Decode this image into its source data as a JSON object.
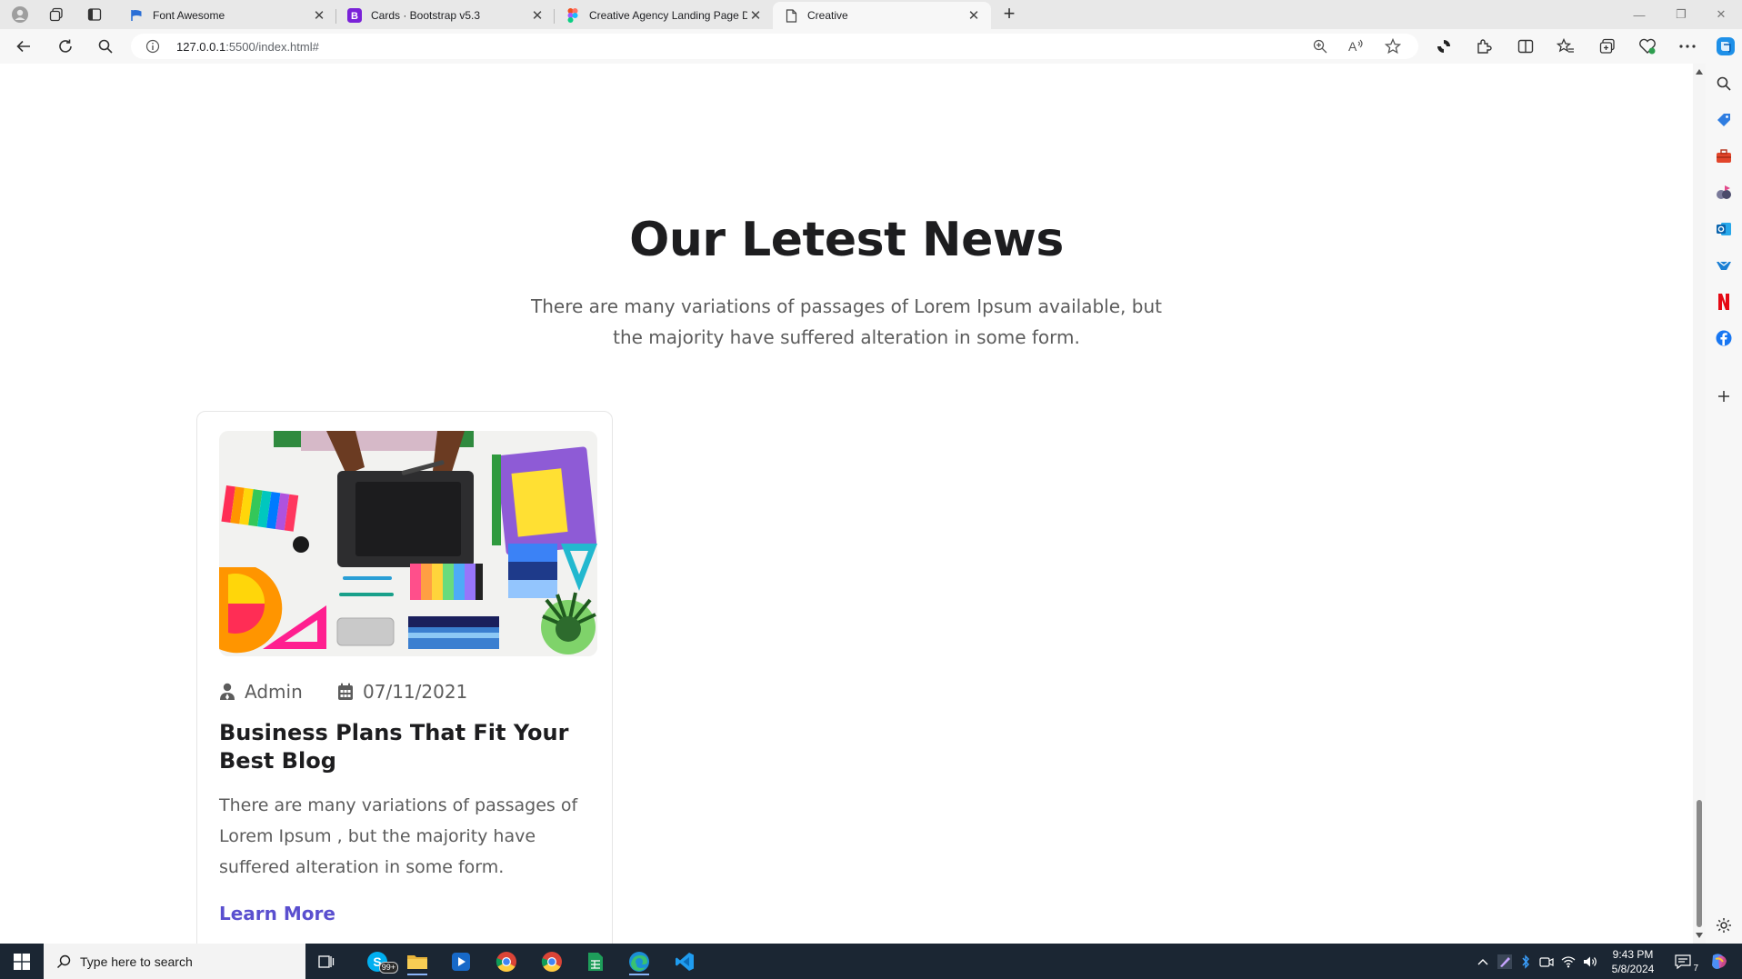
{
  "browser": {
    "tabs": [
      {
        "title": "Font Awesome",
        "icon": "font-awesome-flag-icon",
        "active": false
      },
      {
        "title": "Cards · Bootstrap v5.3",
        "icon": "bootstrap-icon",
        "active": false
      },
      {
        "title": "Creative Agency Landing Page Design",
        "icon": "figma-icon",
        "active": false
      },
      {
        "title": "Creative",
        "icon": "page-icon",
        "active": true
      }
    ],
    "address": {
      "host": "127.0.0.1",
      "path": ":5500/index.html#"
    }
  },
  "section": {
    "heading": "Our Letest News",
    "subtext": "There are many variations of passages of Lorem Ipsum available, but the majority have suffered alteration in some form."
  },
  "card": {
    "author": "Admin",
    "date": "07/11/2021",
    "title": "Business Plans That Fit Your Best Blog",
    "text": "There are many variations of passages of Lorem Ipsum , but the majority have suffered alteration in some form.",
    "link": "Learn More",
    "image_icon": "design-desk-photo"
  },
  "colors": {
    "accent": "#5a4fcf",
    "heading": "#1d1d1f",
    "body_text": "#5c5c5c",
    "taskbar": "#1b2633"
  },
  "taskbar": {
    "search_placeholder": "Type here to search",
    "skype_badge": "99+",
    "time": "9:43 PM",
    "date": "5/8/2024",
    "notifications": "7"
  }
}
